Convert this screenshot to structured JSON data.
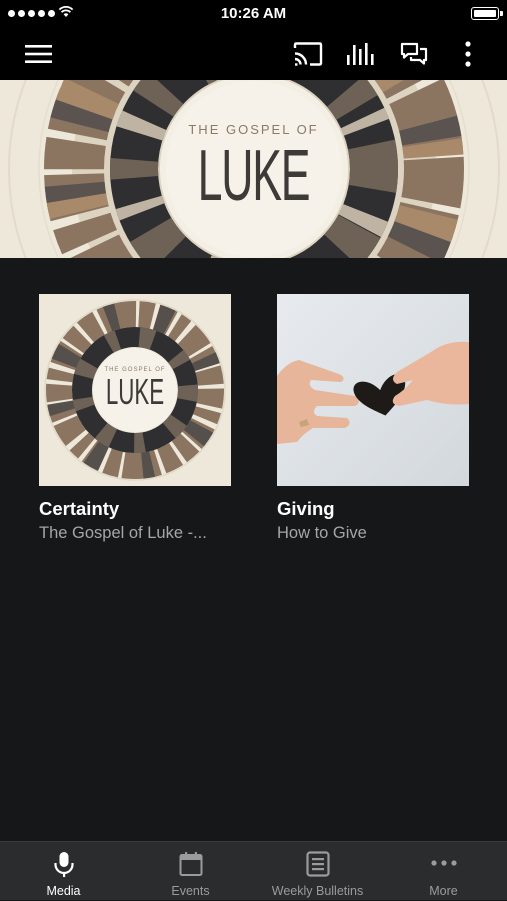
{
  "status_bar": {
    "time": "10:26 AM"
  },
  "app_bar": {
    "icons": [
      "menu-icon",
      "cast-icon",
      "audio-bars-icon",
      "chat-icon",
      "more-vertical-icon"
    ]
  },
  "hero": {
    "title_small": "THE GOSPEL OF",
    "title_large": "LUKE"
  },
  "cards": [
    {
      "title": "Certainty",
      "subtitle": "The Gospel of Luke -...",
      "artwork": {
        "small": "THE GOSPEL OF",
        "large": "LUKE"
      }
    },
    {
      "title": "Giving",
      "subtitle": "How to Give"
    }
  ],
  "bottom_nav": {
    "items": [
      {
        "label": "Media",
        "icon": "microphone-icon",
        "active": true
      },
      {
        "label": "Events",
        "icon": "calendar-icon",
        "active": false
      },
      {
        "label": "Weekly Bulletins",
        "icon": "bulletin-icon",
        "active": false
      },
      {
        "label": "More",
        "icon": "more-horizontal-icon",
        "active": false
      }
    ]
  },
  "colors": {
    "background": "#161719",
    "app_bar": "#000000",
    "bottom_nav": "#2b2c2e",
    "subtitle": "#a6a6a8",
    "nav_inactive": "#9a9b9d"
  }
}
